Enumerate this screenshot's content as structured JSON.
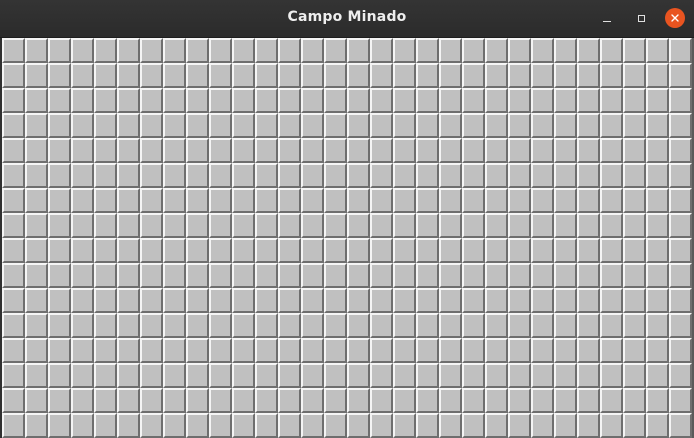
{
  "window": {
    "title": "Campo Minado",
    "controls": {
      "minimize": "minimize-icon",
      "maximize": "maximize-icon",
      "close": "close-icon"
    },
    "accent_close_color": "#e95420"
  },
  "board": {
    "rows": 16,
    "columns": 30,
    "cell_state": "unrevealed",
    "cell_color": "#c0c0c0"
  }
}
